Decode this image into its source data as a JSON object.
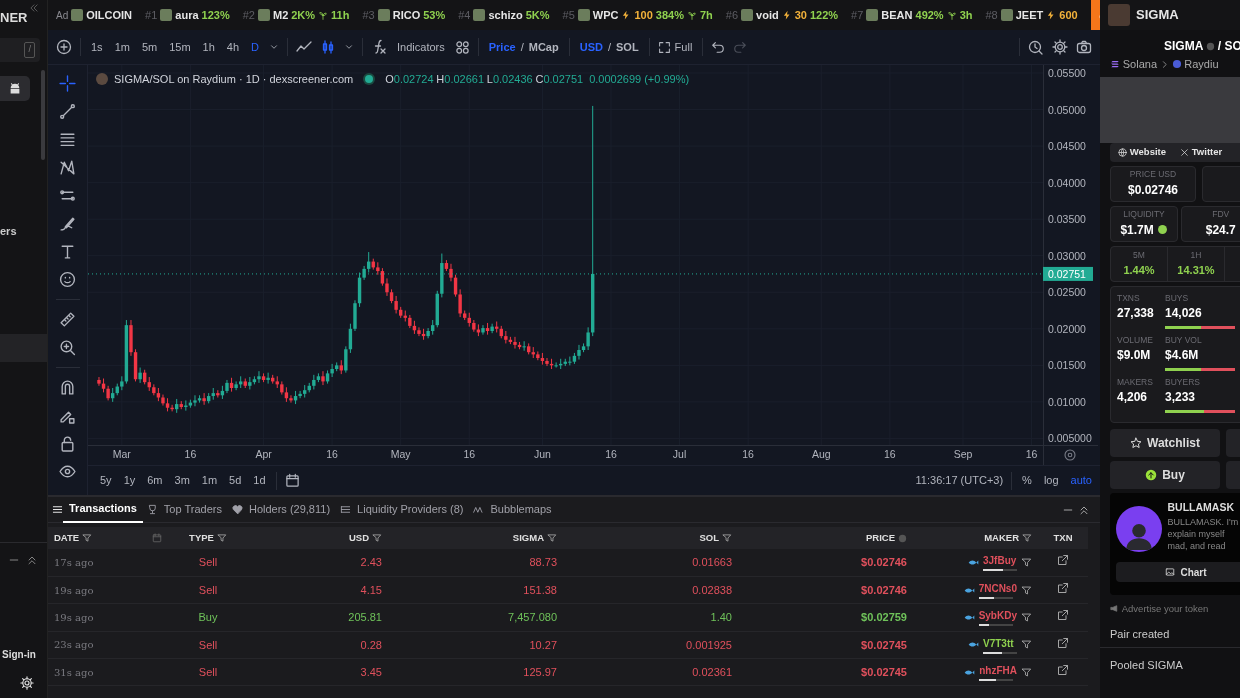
{
  "sidebar": {
    "brand_fragment": "NER",
    "search_shortcut": "/",
    "menu_fragment": "ers",
    "sign_in": "Sign-in"
  },
  "ticker": {
    "items": [
      {
        "kind": "ad",
        "rank": "Ad",
        "name": "OILCOIN"
      },
      {
        "kind": "ranked",
        "rank": "#1",
        "name": "aura",
        "change": "123%"
      },
      {
        "kind": "ranked",
        "rank": "#2",
        "name": "M2",
        "change": "2K%",
        "age": "11h"
      },
      {
        "kind": "ranked",
        "rank": "#3",
        "name": "RICO",
        "change": "53%"
      },
      {
        "kind": "ranked",
        "rank": "#4",
        "name": "schizo",
        "change": "5K%"
      },
      {
        "kind": "ranked",
        "rank": "#5",
        "name": "WPC",
        "boost": "100",
        "change": "384%",
        "age": "7h"
      },
      {
        "kind": "ranked",
        "rank": "#6",
        "name": "void",
        "boost": "30",
        "change": "122%"
      },
      {
        "kind": "ranked",
        "rank": "#7",
        "name": "BEAN",
        "change": "492%",
        "age": "3h"
      },
      {
        "kind": "ranked",
        "rank": "#8",
        "name": "JEET",
        "boost": "600"
      }
    ]
  },
  "header": {
    "token": "SIGMA"
  },
  "toolbar": {
    "intervals": [
      {
        "label": "1s",
        "selected": false
      },
      {
        "label": "1m",
        "selected": false
      },
      {
        "label": "5m",
        "selected": false
      },
      {
        "label": "15m",
        "selected": false
      },
      {
        "label": "1h",
        "selected": false
      },
      {
        "label": "4h",
        "selected": false
      },
      {
        "label": "D",
        "selected": true
      }
    ],
    "indicators": "Indicators",
    "toggles": [
      {
        "separator": "/",
        "options": [
          {
            "label": "Price",
            "selected": true
          },
          {
            "label": "MCap",
            "selected": false
          }
        ]
      },
      {
        "separator": "/",
        "options": [
          {
            "label": "USD",
            "selected": true
          },
          {
            "label": "SOL",
            "selected": false
          }
        ]
      }
    ],
    "full": "Full"
  },
  "chart": {
    "legend": {
      "title": "SIGMA/SOL on Raydium · 1D · dexscreener.com",
      "ohlc": [
        {
          "label": "O",
          "value": "0.02724"
        },
        {
          "label": "H",
          "value": "0.02661"
        },
        {
          "label": "L",
          "value": "0.02436"
        },
        {
          "label": "C",
          "value": "0.02751"
        }
      ],
      "change": "0.0002699 (+0.99%)"
    },
    "chart_data": {
      "type": "candlestick",
      "grid": true,
      "ylim": [
        0.0041,
        0.0561
      ],
      "ref_lines": [
        {
          "axis": "y",
          "value": 0.02751,
          "label": "0.02751"
        }
      ],
      "categories": [
        null,
        null,
        null,
        null,
        null,
        "Mar",
        null,
        null,
        null,
        null,
        null,
        null,
        null,
        null,
        null,
        null,
        null,
        null,
        null,
        null,
        "16",
        null,
        null,
        null,
        null,
        null,
        null,
        null,
        null,
        null,
        null,
        null,
        null,
        null,
        null,
        null,
        "Apr",
        null,
        null,
        null,
        null,
        null,
        null,
        null,
        null,
        null,
        null,
        null,
        null,
        null,
        null,
        "16",
        null,
        null,
        null,
        null,
        null,
        null,
        null,
        null,
        null,
        null,
        null,
        null,
        null,
        null,
        "May",
        null,
        null,
        null,
        null,
        null,
        null,
        null,
        null,
        null,
        null,
        null,
        null,
        null,
        null,
        "16",
        null,
        null,
        null,
        null,
        null,
        null,
        null,
        null,
        null,
        null,
        null,
        null,
        null,
        null,
        null,
        "Jun",
        null,
        null,
        null,
        null,
        null,
        null,
        null,
        null,
        null,
        null,
        null,
        null,
        null,
        null,
        "16",
        null,
        null,
        null,
        null,
        null,
        null,
        null,
        null,
        null,
        null,
        null,
        null,
        null,
        null,
        "Jul",
        null,
        null,
        null,
        null,
        null,
        null,
        null,
        null,
        null,
        null,
        null,
        null,
        null,
        null,
        "16",
        null,
        null,
        null,
        null,
        null,
        null,
        null,
        null,
        null,
        null,
        null,
        null,
        null,
        null,
        null,
        "Aug",
        null,
        null,
        null,
        null,
        null,
        null,
        null,
        null,
        null,
        null,
        null,
        null,
        null,
        null,
        "16",
        null,
        null,
        null,
        null,
        null,
        null,
        null,
        null,
        null,
        null,
        null,
        null,
        null,
        null,
        null,
        "Sep",
        null,
        null,
        null,
        null,
        null,
        null,
        null,
        null,
        null,
        null,
        null,
        null,
        null,
        null,
        "16",
        null,
        null
      ],
      "ohlc": [
        [
          0.013,
          0.0134,
          0.0122,
          0.0125
        ],
        [
          0.0125,
          0.0132,
          0.0113,
          0.0118
        ],
        [
          0.0118,
          0.0122,
          0.0102,
          0.0105
        ],
        [
          0.0105,
          0.0119,
          0.01,
          0.0112
        ],
        [
          0.0112,
          0.0125,
          0.0109,
          0.0121
        ],
        [
          0.0121,
          0.0135,
          0.0116,
          0.0128
        ],
        [
          0.0128,
          0.0212,
          0.0125,
          0.0205
        ],
        [
          0.0205,
          0.0212,
          0.0163,
          0.0168
        ],
        [
          0.0168,
          0.0172,
          0.0128,
          0.0131
        ],
        [
          0.0131,
          0.0147,
          0.0126,
          0.014
        ],
        [
          0.014,
          0.0144,
          0.0124,
          0.0127
        ],
        [
          0.0127,
          0.0134,
          0.0115,
          0.012
        ],
        [
          0.012,
          0.0124,
          0.0109,
          0.0112
        ],
        [
          0.0112,
          0.0119,
          0.0101,
          0.0106
        ],
        [
          0.0106,
          0.011,
          0.0095,
          0.0098
        ],
        [
          0.0098,
          0.0105,
          0.0087,
          0.0092
        ],
        [
          0.0092,
          0.0096,
          0.0087,
          0.009
        ],
        [
          0.009,
          0.0104,
          0.0085,
          0.0097
        ],
        [
          0.0097,
          0.0101,
          0.009,
          0.0093
        ],
        [
          0.0093,
          0.0102,
          0.0088,
          0.0095
        ],
        [
          0.0095,
          0.0103,
          0.0092,
          0.0099
        ],
        [
          0.0099,
          0.0109,
          0.0094,
          0.0102
        ],
        [
          0.0102,
          0.0109,
          0.0099,
          0.0105
        ],
        [
          0.0105,
          0.0112,
          0.0096,
          0.0101
        ],
        [
          0.0101,
          0.0112,
          0.0098,
          0.0108
        ],
        [
          0.0108,
          0.0119,
          0.0103,
          0.0112
        ],
        [
          0.0112,
          0.0116,
          0.0106,
          0.0109
        ],
        [
          0.0109,
          0.0122,
          0.0104,
          0.0115
        ],
        [
          0.0115,
          0.013,
          0.0112,
          0.0126
        ],
        [
          0.0126,
          0.0133,
          0.0114,
          0.0119
        ],
        [
          0.0119,
          0.0128,
          0.0116,
          0.0124
        ],
        [
          0.0124,
          0.0135,
          0.0119,
          0.0128
        ],
        [
          0.0128,
          0.0132,
          0.0119,
          0.0122
        ],
        [
          0.0122,
          0.0134,
          0.0117,
          0.0127
        ],
        [
          0.0127,
          0.0135,
          0.0124,
          0.0131
        ],
        [
          0.0131,
          0.0142,
          0.0126,
          0.0135
        ],
        [
          0.0135,
          0.0139,
          0.0127,
          0.013
        ],
        [
          0.013,
          0.014,
          0.0125,
          0.0133
        ],
        [
          0.0133,
          0.0137,
          0.0125,
          0.0128
        ],
        [
          0.0128,
          0.0135,
          0.0119,
          0.0124
        ],
        [
          0.0124,
          0.0128,
          0.011,
          0.0113
        ],
        [
          0.0113,
          0.012,
          0.01,
          0.0105
        ],
        [
          0.0105,
          0.0109,
          0.0099,
          0.0102
        ],
        [
          0.0102,
          0.0115,
          0.0097,
          0.0108
        ],
        [
          0.0108,
          0.0115,
          0.0105,
          0.0111
        ],
        [
          0.0111,
          0.0123,
          0.0106,
          0.0116
        ],
        [
          0.0116,
          0.0126,
          0.0113,
          0.0122
        ],
        [
          0.0122,
          0.0137,
          0.0117,
          0.013
        ],
        [
          0.013,
          0.0139,
          0.0127,
          0.0135
        ],
        [
          0.0135,
          0.0142,
          0.0123,
          0.0128
        ],
        [
          0.0128,
          0.0143,
          0.0125,
          0.0139
        ],
        [
          0.0139,
          0.0152,
          0.0134,
          0.0145
        ],
        [
          0.0145,
          0.0154,
          0.0142,
          0.015
        ],
        [
          0.015,
          0.0157,
          0.0138,
          0.0143
        ],
        [
          0.0143,
          0.0176,
          0.014,
          0.0172
        ],
        [
          0.0172,
          0.0207,
          0.0167,
          0.02
        ],
        [
          0.02,
          0.0239,
          0.0197,
          0.0235
        ],
        [
          0.0235,
          0.0277,
          0.023,
          0.027
        ],
        [
          0.027,
          0.0286,
          0.0267,
          0.0282
        ],
        [
          0.0282,
          0.0305,
          0.0277,
          0.0292
        ],
        [
          0.0292,
          0.0296,
          0.0281,
          0.0284
        ],
        [
          0.0284,
          0.0291,
          0.0274,
          0.0279
        ],
        [
          0.0279,
          0.0283,
          0.0259,
          0.0262
        ],
        [
          0.0262,
          0.0269,
          0.0245,
          0.025
        ],
        [
          0.025,
          0.0254,
          0.0235,
          0.0238
        ],
        [
          0.0238,
          0.0245,
          0.0221,
          0.0226
        ],
        [
          0.0226,
          0.023,
          0.0215,
          0.0218
        ],
        [
          0.0218,
          0.0225,
          0.021,
          0.0215
        ],
        [
          0.0215,
          0.0219,
          0.0201,
          0.0204
        ],
        [
          0.0204,
          0.0211,
          0.0193,
          0.0198
        ],
        [
          0.0198,
          0.0202,
          0.019,
          0.0193
        ],
        [
          0.0193,
          0.02,
          0.0185,
          0.019
        ],
        [
          0.019,
          0.0201,
          0.0187,
          0.0197
        ],
        [
          0.0197,
          0.0212,
          0.0192,
          0.0205
        ],
        [
          0.0205,
          0.0252,
          0.0202,
          0.0248
        ],
        [
          0.0248,
          0.0303,
          0.0243,
          0.029
        ],
        [
          0.029,
          0.0294,
          0.0279,
          0.0282
        ],
        [
          0.0282,
          0.0289,
          0.0265,
          0.027
        ],
        [
          0.027,
          0.0274,
          0.0244,
          0.0247
        ],
        [
          0.0247,
          0.0254,
          0.0216,
          0.0221
        ],
        [
          0.0221,
          0.0225,
          0.0212,
          0.0215
        ],
        [
          0.0215,
          0.0222,
          0.0203,
          0.0208
        ],
        [
          0.0208,
          0.0212,
          0.0196,
          0.0199
        ],
        [
          0.0199,
          0.0206,
          0.019,
          0.0195
        ],
        [
          0.0195,
          0.0205,
          0.0192,
          0.0201
        ],
        [
          0.0201,
          0.0208,
          0.0192,
          0.0197
        ],
        [
          0.0197,
          0.0207,
          0.0194,
          0.0203
        ],
        [
          0.0203,
          0.021,
          0.0195,
          0.02
        ],
        [
          0.02,
          0.0204,
          0.0187,
          0.019
        ],
        [
          0.019,
          0.0197,
          0.018,
          0.0185
        ],
        [
          0.0185,
          0.0189,
          0.0179,
          0.0182
        ],
        [
          0.0182,
          0.0189,
          0.0173,
          0.0178
        ],
        [
          0.0178,
          0.0182,
          0.0172,
          0.0175
        ],
        [
          0.0175,
          0.0183,
          0.017,
          0.0176
        ],
        [
          0.0176,
          0.018,
          0.0165,
          0.0168
        ],
        [
          0.0168,
          0.0175,
          0.016,
          0.0165
        ],
        [
          0.0165,
          0.0169,
          0.0157,
          0.016
        ],
        [
          0.016,
          0.0167,
          0.0151,
          0.0156
        ],
        [
          0.0156,
          0.016,
          0.0149,
          0.0152
        ],
        [
          0.0152,
          0.0159,
          0.0145,
          0.015
        ],
        [
          0.015,
          0.0154,
          0.0147,
          0.015
        ],
        [
          0.015,
          0.0159,
          0.0145,
          0.0152
        ],
        [
          0.0152,
          0.0159,
          0.0149,
          0.0155
        ],
        [
          0.0155,
          0.0162,
          0.015,
          0.0155
        ],
        [
          0.0155,
          0.0167,
          0.0152,
          0.0163
        ],
        [
          0.0163,
          0.0178,
          0.0158,
          0.0171
        ],
        [
          0.0171,
          0.018,
          0.0168,
          0.0176
        ],
        [
          0.0176,
          0.0202,
          0.0171,
          0.0195
        ],
        [
          0.0195,
          0.0505,
          0.019,
          0.02751
        ],
        null,
        null,
        null,
        null,
        null,
        null,
        null,
        null,
        null,
        null,
        null,
        null,
        null,
        null,
        null,
        null,
        null,
        null,
        null,
        null,
        null,
        null,
        null,
        null,
        null,
        null,
        null,
        null,
        null,
        null,
        null,
        null,
        null,
        null,
        null,
        null,
        null,
        null,
        null,
        null,
        null,
        null,
        null,
        null,
        null,
        null,
        null,
        null,
        null,
        null,
        null,
        null,
        null,
        null,
        null,
        null,
        null,
        null,
        null,
        null,
        null,
        null,
        null,
        null,
        null,
        null,
        null,
        null,
        null,
        null,
        null,
        null,
        null,
        null,
        null,
        null,
        null,
        null,
        null,
        null,
        null,
        null,
        null,
        null,
        null,
        null,
        null,
        null,
        null,
        null,
        null,
        null,
        null,
        null,
        null,
        null,
        null,
        null
      ],
      "yticks": [
        {
          "value": 0.055,
          "label": "0.05500"
        },
        {
          "value": 0.05,
          "label": "0.05000"
        },
        {
          "value": 0.045,
          "label": "0.04500"
        },
        {
          "value": 0.04,
          "label": "0.04000"
        },
        {
          "value": 0.035,
          "label": "0.03500"
        },
        {
          "value": 0.03,
          "label": "0.03000"
        },
        {
          "value": 0.025,
          "label": "0.02500"
        },
        {
          "value": 0.02,
          "label": "0.02000"
        },
        {
          "value": 0.015,
          "label": "0.01500"
        },
        {
          "value": 0.01,
          "label": "0.01000"
        },
        {
          "value": 0.005,
          "label": "0.005000"
        }
      ]
    },
    "ranges": [
      "5y",
      "1y",
      "6m",
      "3m",
      "1m",
      "5d",
      "1d"
    ],
    "clock": "11:36:17 (UTC+3)",
    "scale_options": [
      {
        "label": "%",
        "selected": false
      },
      {
        "label": "log",
        "selected": false
      },
      {
        "label": "auto",
        "selected": true
      }
    ]
  },
  "bottom_tabs": [
    {
      "kind": "list",
      "label": "Transactions",
      "selected": true
    },
    {
      "kind": "trophy",
      "label": "Top Traders",
      "selected": false
    },
    {
      "kind": "heart",
      "label": "Holders (29,811)",
      "selected": false
    },
    {
      "kind": "bars",
      "label": "Liquidity Providers (8)",
      "selected": false
    },
    {
      "kind": "bubbles",
      "label": "Bubblemaps",
      "selected": false
    }
  ],
  "table": {
    "columns": [
      "DATE",
      "TYPE",
      "USD",
      "SIGMA",
      "SOL",
      "PRICE",
      "MAKER",
      "TXN"
    ],
    "rows": [
      {
        "date": "17s ago",
        "type": "Sell",
        "usd": "2.43",
        "sigma": "88.73",
        "sol": "0.01663",
        "price": "$0.02746",
        "maker": {
          "name": "3JfBuy",
          "color": "#e0505c",
          "level": 0.6
        }
      },
      {
        "date": "19s ago",
        "type": "Sell",
        "usd": "4.15",
        "sigma": "151.38",
        "sol": "0.02838",
        "price": "$0.02746",
        "maker": {
          "name": "7NCNs0",
          "color": "#e0505c",
          "level": 0.45
        }
      },
      {
        "date": "19s ago",
        "type": "Buy",
        "usd": "205.81",
        "sigma": "7,457.080",
        "sol": "1.40",
        "price": "$0.02759",
        "maker": {
          "name": "SybKDy",
          "color": "#e0505c",
          "level": 0.3
        }
      },
      {
        "date": "23s ago",
        "type": "Sell",
        "usd": "0.28",
        "sigma": "10.27",
        "sol": "0.001925",
        "price": "$0.02745",
        "maker": {
          "name": "V7T3tt",
          "color": "#8fd14f",
          "level": 0.55
        }
      },
      {
        "date": "31s ago",
        "type": "Sell",
        "usd": "3.45",
        "sigma": "125.97",
        "sol": "0.02361",
        "price": "$0.02745",
        "maker": {
          "name": "nhzFHA",
          "color": "#e0505c",
          "level": 0.5
        }
      }
    ]
  },
  "pair": {
    "base": "SIGMA",
    "quote": "/ SO",
    "chain": "Solana",
    "dex": "Raydiu",
    "links": [
      "Website",
      "Twitter"
    ],
    "price_usd": {
      "label": "PRICE USD",
      "value": "$0.02746"
    },
    "liquidity": {
      "label": "LIQUIDITY",
      "value": "$1.7M"
    },
    "fdv": {
      "label": "FDV",
      "value": "$24.7"
    },
    "changes": [
      {
        "label": "5M",
        "value": "1.44%"
      },
      {
        "label": "1H",
        "value": "14.31%"
      }
    ],
    "stats": [
      {
        "label": "TXNS",
        "value": "27,338",
        "side_label": "BUYS",
        "side_value": "14,026",
        "level": 0.51
      },
      {
        "label": "VOLUME",
        "value": "$9.0M",
        "side_label": "BUY VOL",
        "side_value": "$4.6M",
        "level": 0.51
      },
      {
        "label": "MAKERS",
        "value": "4,206",
        "side_label": "BUYERS",
        "side_value": "3,233",
        "level": 0.55
      }
    ],
    "watchlist": "Watchlist",
    "buy": "Buy",
    "profile": {
      "name": "BULLAMASK",
      "description": [
        "BULLAMASK. I'm",
        "explain myself",
        "mad, and read"
      ],
      "chart": "Chart"
    },
    "advertise": "Advertise your token",
    "info_rows": [
      "Pair created",
      "Pooled SIGMA"
    ]
  }
}
